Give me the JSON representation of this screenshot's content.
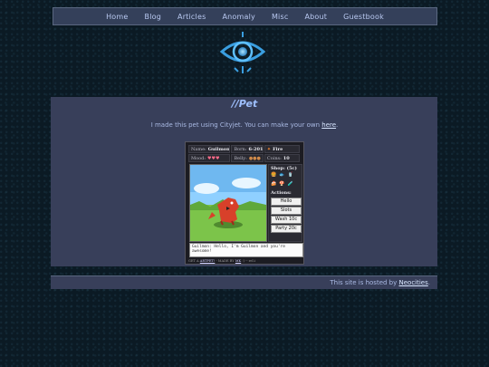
{
  "nav": [
    "Home",
    "Blog",
    "Articles",
    "Anomaly",
    "Misc",
    "About",
    "Guestbook"
  ],
  "page": {
    "title": "//Pet",
    "intro_text": "I made this pet using Cityjet. You can make your own ",
    "intro_link": "here",
    "intro_end": "."
  },
  "pet": {
    "name_label": "Name:",
    "name": "Guilmon",
    "born_label": "Born:",
    "born": "6-2018",
    "element": "Fire",
    "mood_label": "Mood:",
    "mood": "♥♥♥",
    "belly_label": "Belly:",
    "belly": "●●●",
    "coins_label": "Coins:",
    "coins": "10",
    "shop_header": "Shop: (5c)",
    "actions_label": "Actions:",
    "actions": [
      "Hello",
      "Slots",
      "Wash 10c",
      "Party 20c"
    ],
    "chat": "Guilmon: Hello, I'm Guilmon and you're awesome!",
    "footer_prefix": "GET A ",
    "footer_link": "ARTPET!",
    "footer_mid": " - MADE BY ",
    "footer_link2": "MK",
    "footer_end": " :) -- rel.i"
  },
  "footer": {
    "text": "This site is hosted by ",
    "link": "Neocities",
    "end": "."
  },
  "colors": {
    "background": "#0b1a24",
    "panel": "#383f5a",
    "accent": "#9fc0ff"
  }
}
